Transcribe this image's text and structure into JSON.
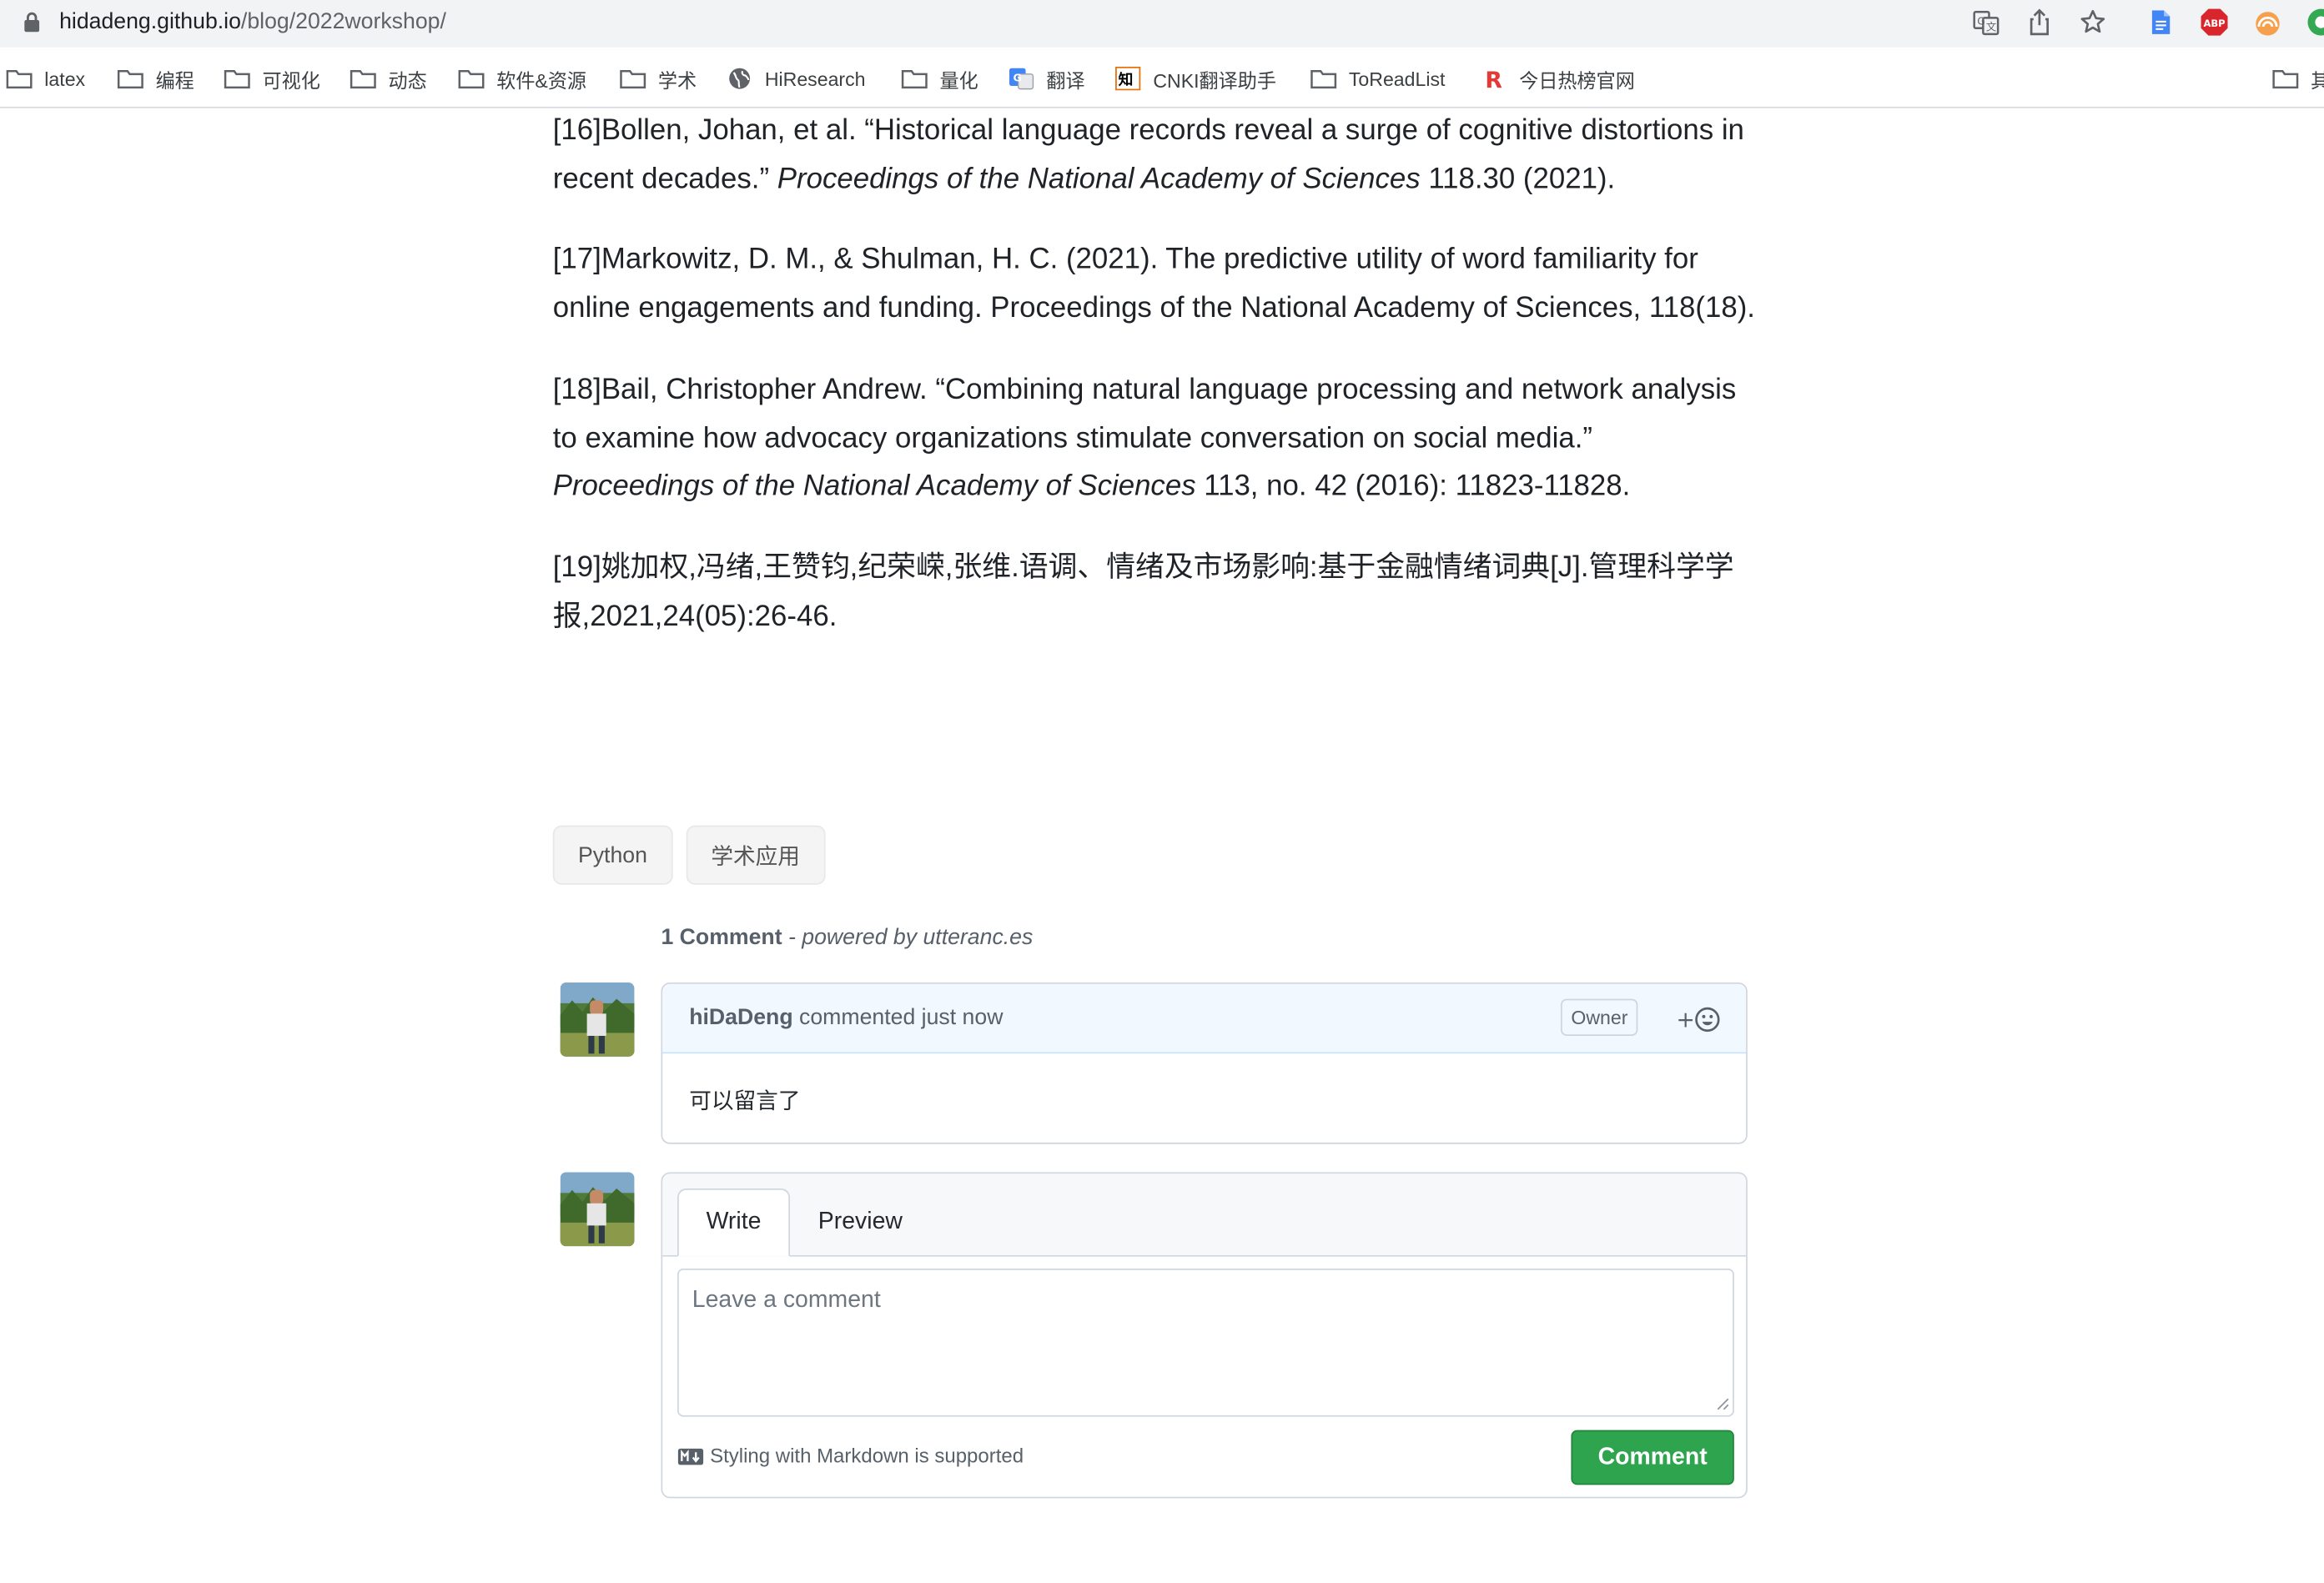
{
  "browser": {
    "url_host": "hidadeng.github.io",
    "url_path": "/blog/2022workshop/"
  },
  "bookmarks": [
    {
      "label": "latex",
      "icon": "folder-icon"
    },
    {
      "label": "编程",
      "icon": "folder-icon"
    },
    {
      "label": "可视化",
      "icon": "folder-icon"
    },
    {
      "label": "动态",
      "icon": "folder-icon"
    },
    {
      "label": "软件&资源",
      "icon": "folder-icon"
    },
    {
      "label": "学术",
      "icon": "folder-icon"
    },
    {
      "label": "HiResearch",
      "icon": "globe-icon"
    },
    {
      "label": "量化",
      "icon": "folder-icon"
    },
    {
      "label": "翻译",
      "icon": "google-translate-icon"
    },
    {
      "label": "CNKI翻译助手",
      "icon": "cnki-icon"
    },
    {
      "label": "ToReadList",
      "icon": "folder-icon"
    },
    {
      "label": "今日热榜官网",
      "icon": "r-logo-icon"
    },
    {
      "label": "其",
      "icon": "folder-icon"
    }
  ],
  "extensions": {
    "abp_label": "ABP"
  },
  "references": [
    {
      "pre": "[16]Bollen, Johan, et al. “Historical language records reveal a surge of cognitive distortions in recent decades.” ",
      "journal": "Proceedings of the National Academy of Sciences",
      "post": " 118.30 (2021)."
    },
    {
      "text": "[17]Markowitz, D. M., & Shulman, H. C. (2021). The predictive utility of word familiarity for online engagements and funding. Proceedings of the National Academy of Sciences, 118(18)."
    },
    {
      "pre": "[18]Bail, Christopher Andrew. “Combining natural language processing and network analysis to examine how advocacy organizations stimulate conversation on social media.” ",
      "journal": "Proceedings of the National Academy of Sciences",
      "post": " 113, no. 42 (2016): 11823-11828."
    },
    {
      "text": "[19]姚加权,冯绪,王赞钧,纪荣嵘,张维.语调、情绪及市场影响:基于金融情绪词典[J].管理科学学报,2021,24(05):26-46."
    }
  ],
  "tags": [
    "Python",
    "学术应用"
  ],
  "comments": {
    "count": "1 Comment",
    "powered_by": " - powered by utteranc.es",
    "items": [
      {
        "author": "hiDaDeng",
        "meta": " commented just now",
        "badge": "Owner",
        "reaction_label": "+",
        "body": "可以留言了"
      }
    ],
    "new_comment": {
      "tab_write": "Write",
      "tab_preview": "Preview",
      "placeholder": "Leave a comment",
      "markdown_note": "Styling with Markdown is supported",
      "submit": "Comment"
    }
  },
  "colors": {
    "accent_green": "#2ea44f",
    "comment_header_bg": "#f1f8ff",
    "abp_red": "#d9262c"
  }
}
